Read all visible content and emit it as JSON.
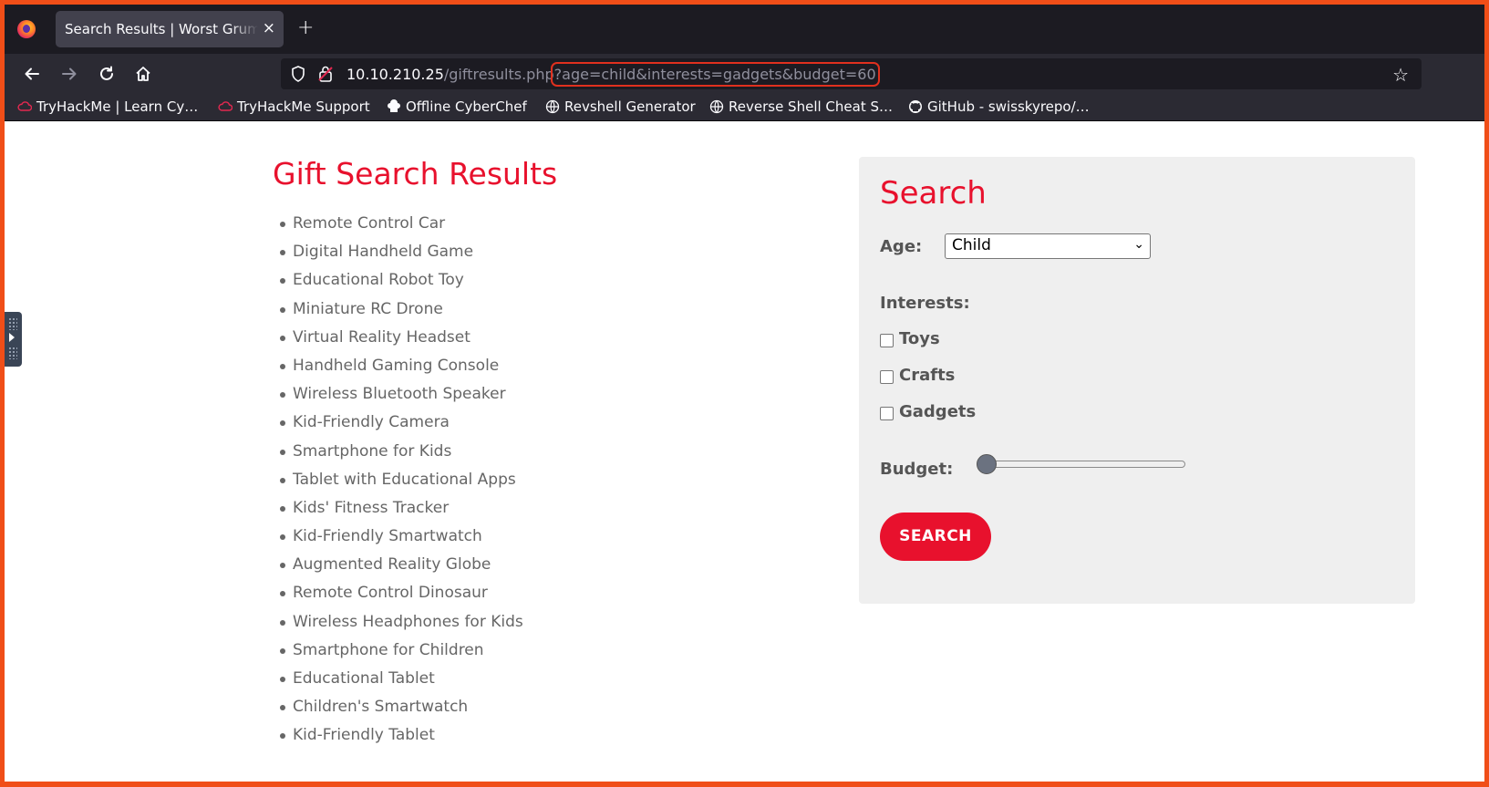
{
  "browser": {
    "tab_title": "Search Results | Worst Grum",
    "tab_close_glyph": "×",
    "new_tab_glyph": "+",
    "url_host": "10.10.210.25",
    "url_path": "/giftresults.php",
    "url_query": "?age=child&interests=gadgets&budget=60",
    "bookmarks": [
      {
        "label": "TryHackMe | Learn Cy…",
        "icon": "tryhackme-cloud-icon"
      },
      {
        "label": "TryHackMe Support",
        "icon": "tryhackme-cloud-icon"
      },
      {
        "label": "Offline CyberChef",
        "icon": "chef-hat-icon"
      },
      {
        "label": "Revshell Generator",
        "icon": "globe-icon"
      },
      {
        "label": "Reverse Shell Cheat S…",
        "icon": "globe-icon"
      },
      {
        "label": "GitHub - swisskyrepo/…",
        "icon": "github-icon"
      }
    ]
  },
  "results": {
    "title": "Gift Search Results",
    "items": [
      "Remote Control Car",
      "Digital Handheld Game",
      "Educational Robot Toy",
      "Miniature RC Drone",
      "Virtual Reality Headset",
      "Handheld Gaming Console",
      "Wireless Bluetooth Speaker",
      "Kid-Friendly Camera",
      "Smartphone for Kids",
      "Tablet with Educational Apps",
      "Kids' Fitness Tracker",
      "Kid-Friendly Smartwatch",
      "Augmented Reality Globe",
      "Remote Control Dinosaur",
      "Wireless Headphones for Kids",
      "Smartphone for Children",
      "Educational Tablet",
      "Children's Smartwatch",
      "Kid-Friendly Tablet"
    ]
  },
  "search": {
    "title": "Search",
    "age_label": "Age:",
    "age_value": "Child",
    "interests_label": "Interests:",
    "interests": [
      {
        "label": "Toys",
        "checked": false
      },
      {
        "label": "Crafts",
        "checked": false
      },
      {
        "label": "Gadgets",
        "checked": false
      }
    ],
    "budget_label": "Budget:",
    "budget_level": 0,
    "button_label": "SEARCH"
  },
  "colors": {
    "accent": "#e8112d",
    "frame": "#f04e18",
    "url_highlight": "#e0301e"
  }
}
